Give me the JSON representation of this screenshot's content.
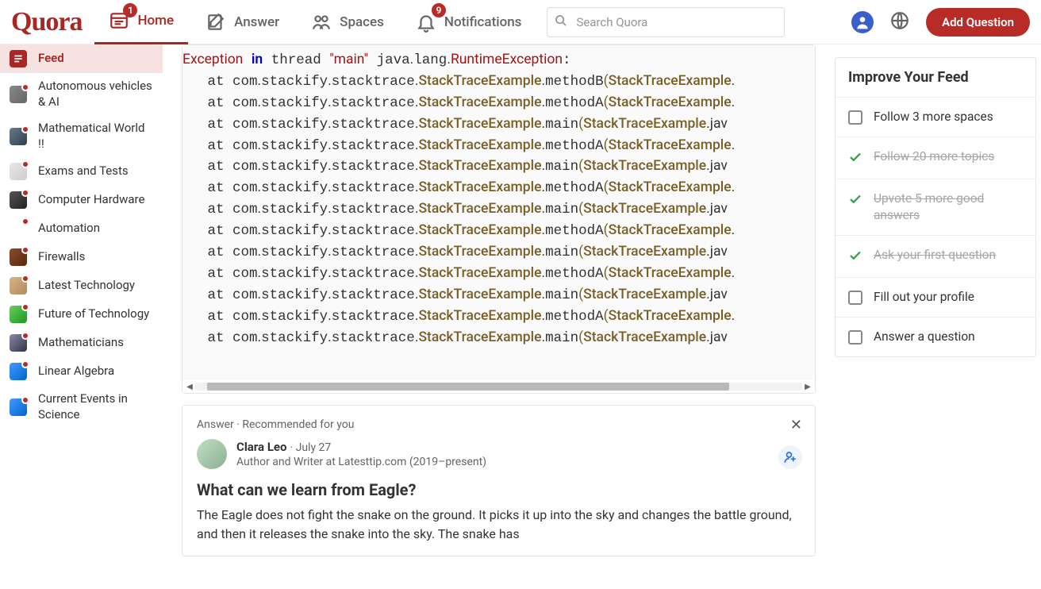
{
  "header": {
    "logo": "Quora",
    "nav": [
      {
        "id": "home",
        "label": "Home",
        "badge": "1"
      },
      {
        "id": "answer",
        "label": "Answer"
      },
      {
        "id": "spaces",
        "label": "Spaces"
      },
      {
        "id": "notifications",
        "label": "Notifications",
        "badge": "9"
      }
    ],
    "search_placeholder": "Search Quora",
    "add_question": "Add Question"
  },
  "sidebar": {
    "feed_label": "Feed",
    "items": [
      "Autonomous vehicles & AI",
      "Mathematical World !!",
      "Exams and Tests",
      "Computer Hardware",
      "Automation",
      "Firewalls",
      "Latest Technology",
      "Future of Technology",
      "Mathematicians",
      "Linear Algebra",
      "Current Events in Science"
    ]
  },
  "code_block": {
    "line0_a": "Exception",
    "line0_b": "in",
    "line0_c": " thread ",
    "line0_d": "\"main\"",
    "line0_e": " java",
    "line0_f": ".",
    "line0_g": "lang",
    "line0_h": ".",
    "line0_i": "RuntimeException",
    "line0_j": ":",
    "frames": [
      {
        "method": "methodB",
        "open": "(",
        "cls": "StackTraceExample",
        "tail": "."
      },
      {
        "method": "methodA",
        "open": "(",
        "cls": "StackTraceExample",
        "tail": "."
      },
      {
        "method": "main",
        "open": "(",
        "cls": "StackTraceExample",
        "tail": ".jav"
      },
      {
        "method": "methodA",
        "open": "(",
        "cls": "StackTraceExample",
        "tail": "."
      },
      {
        "method": "main",
        "open": "(",
        "cls": "StackTraceExample",
        "tail": ".jav"
      },
      {
        "method": "methodA",
        "open": "(",
        "cls": "StackTraceExample",
        "tail": "."
      },
      {
        "method": "main",
        "open": "(",
        "cls": "StackTraceExample",
        "tail": ".jav"
      },
      {
        "method": "methodA",
        "open": "(",
        "cls": "StackTraceExample",
        "tail": "."
      },
      {
        "method": "main",
        "open": "(",
        "cls": "StackTraceExample",
        "tail": ".jav"
      },
      {
        "method": "methodA",
        "open": "(",
        "cls": "StackTraceExample",
        "tail": "."
      },
      {
        "method": "main",
        "open": "(",
        "cls": "StackTraceExample",
        "tail": ".jav"
      },
      {
        "method": "methodA",
        "open": "(",
        "cls": "StackTraceExample",
        "tail": "."
      },
      {
        "method": "main",
        "open": "(",
        "cls": "StackTraceExample",
        "tail": ".jav"
      }
    ],
    "prefix_at": "   at ",
    "pkg": "com",
    "dot": ".",
    "seg1": "stackify",
    "seg2": "stacktrace",
    "cls": "StackTraceExample"
  },
  "post": {
    "meta": "Answer · Recommended for you",
    "author_name": "Clara Leo",
    "author_sep": " · ",
    "author_date": "July 27",
    "author_cred": "Author and Writer at Latesttip.com (2019–present)",
    "title": "What can we learn from Eagle?",
    "body": "The Eagle does not fight the snake on the ground. It picks it up into the sky and changes the battle ground, and then it releases the snake into the sky. The snake has"
  },
  "improve": {
    "title": "Improve Your Feed",
    "tasks": [
      {
        "done": false,
        "label": "Follow 3 more spaces"
      },
      {
        "done": true,
        "label": "Follow 20 more topics"
      },
      {
        "done": true,
        "label": "Upvote 5 more good answers"
      },
      {
        "done": true,
        "label": "Ask your first question"
      },
      {
        "done": false,
        "label": "Fill out your profile"
      },
      {
        "done": false,
        "label": "Answer a question"
      }
    ]
  }
}
